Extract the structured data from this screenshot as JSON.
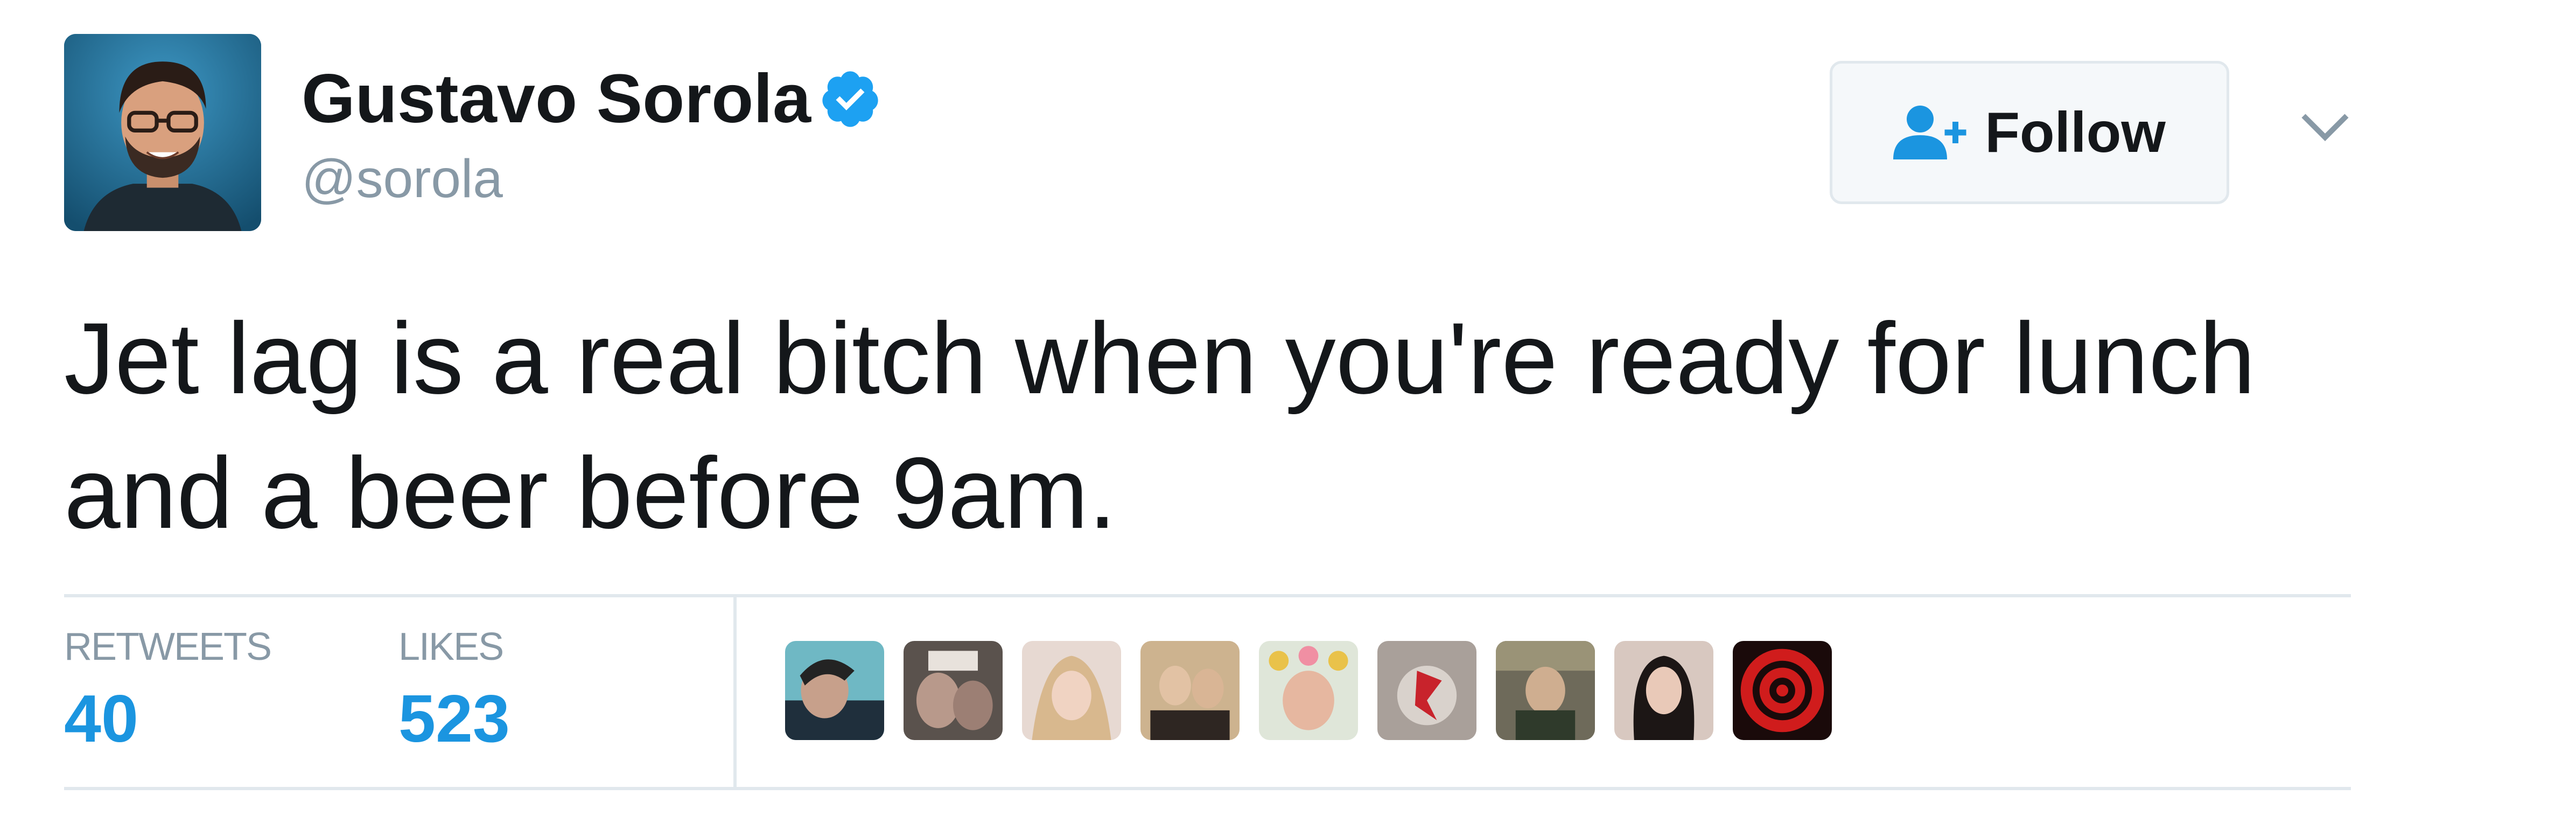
{
  "user": {
    "name": "Gustavo Sorola",
    "handle": "@sorola",
    "verified": true
  },
  "follow_button": {
    "label": "Follow",
    "icon": "follow-user-plus-icon"
  },
  "menu": {
    "icon": "chevron-down-icon"
  },
  "tweet": {
    "lines": [
      "Jet lag is a real bitch when you're ready for lunch",
      "and a beer before 9am."
    ]
  },
  "stats": {
    "retweets_label": "RETWEETS",
    "retweets_count": "40",
    "likes_label": "LIKES",
    "likes_count": "523"
  },
  "likers": {
    "count_shown": 9
  },
  "colors": {
    "text": "#14171a",
    "muted": "#8899a6",
    "accent": "#1b95e0",
    "border": "#e1e8ed",
    "button_bg": "#f5f8fa"
  }
}
